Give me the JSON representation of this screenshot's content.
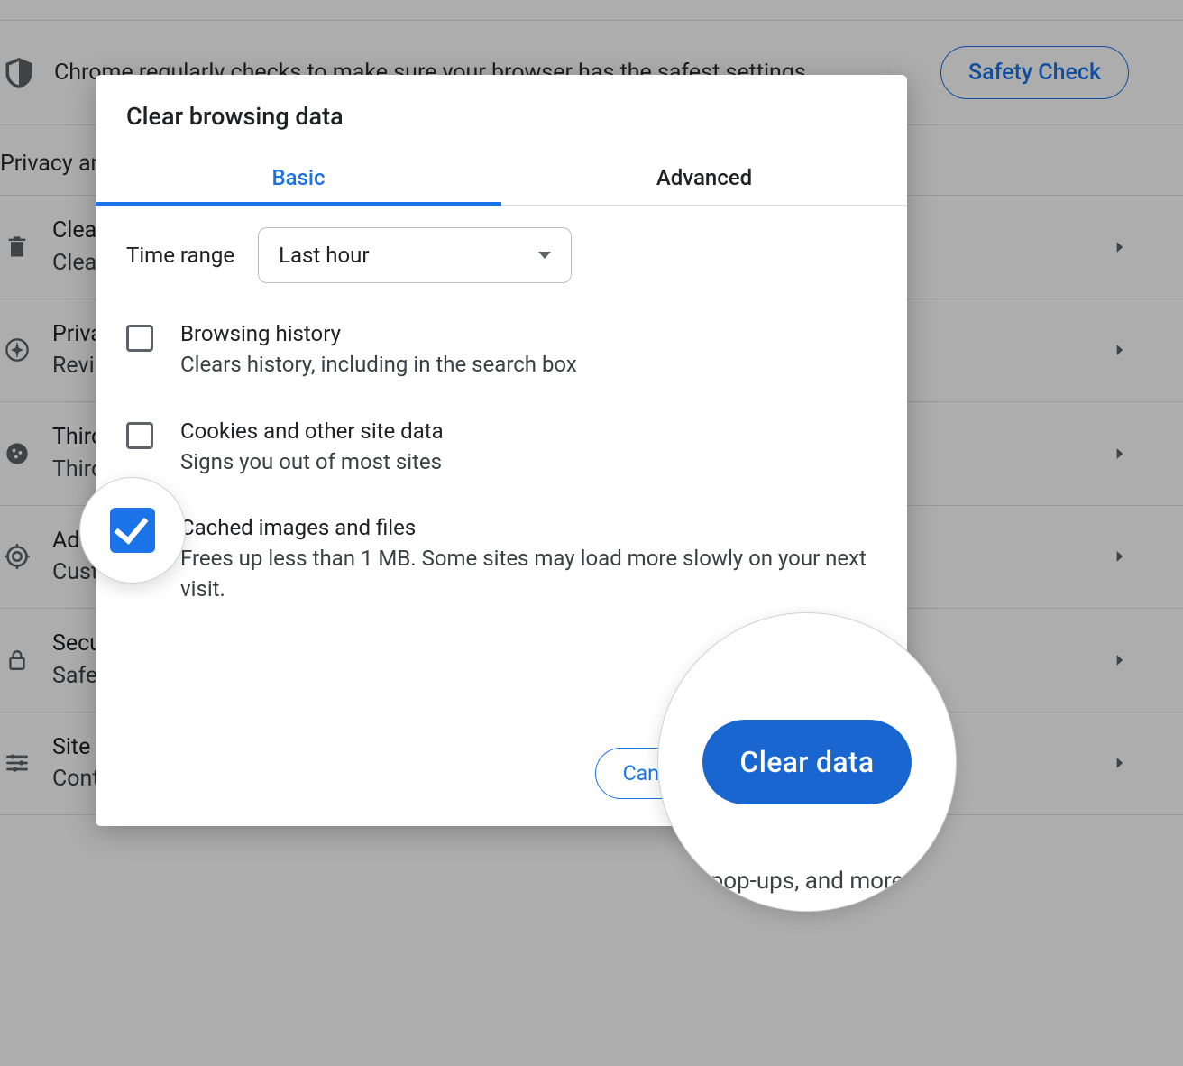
{
  "background": {
    "banner_text": "Chrome regularly checks to make sure your browser has the safest settings.",
    "banner_button": "Safety Check",
    "section_title": "Privacy and security",
    "rows": [
      {
        "title": "Clear browsing data",
        "sub": "Clear history, cookies, cache, and more"
      },
      {
        "title": "Privacy Guide",
        "sub": "Review key privacy and security controls"
      },
      {
        "title": "Third-party cookies",
        "sub": "Third-party cookies are blocked"
      },
      {
        "title": "Ad privacy",
        "sub": "Customize the info used by sites to show you ads"
      },
      {
        "title": "Security",
        "sub": "Safe Browsing (protection from dangerous sites) and other security settings"
      },
      {
        "title": "Site settings",
        "sub": "Controls what information sites can use and show (location, camera, pop-ups, and more)"
      }
    ]
  },
  "dialog": {
    "title": "Clear browsing data",
    "tabs": {
      "basic": "Basic",
      "advanced": "Advanced"
    },
    "time_label": "Time range",
    "time_value": "Last hour",
    "options": [
      {
        "title": "Browsing history",
        "sub": "Clears history, including in the search box",
        "checked": false
      },
      {
        "title": "Cookies and other site data",
        "sub": "Signs you out of most sites",
        "checked": false
      },
      {
        "title": "Cached images and files",
        "sub": "Frees up less than 1 MB. Some sites may load more slowly on your next visit.",
        "checked": true
      }
    ],
    "cancel": "Cancel",
    "confirm": "Clear data"
  },
  "highlight": {
    "big_button": "Clear data",
    "peek_text": "pop-ups, and more"
  }
}
